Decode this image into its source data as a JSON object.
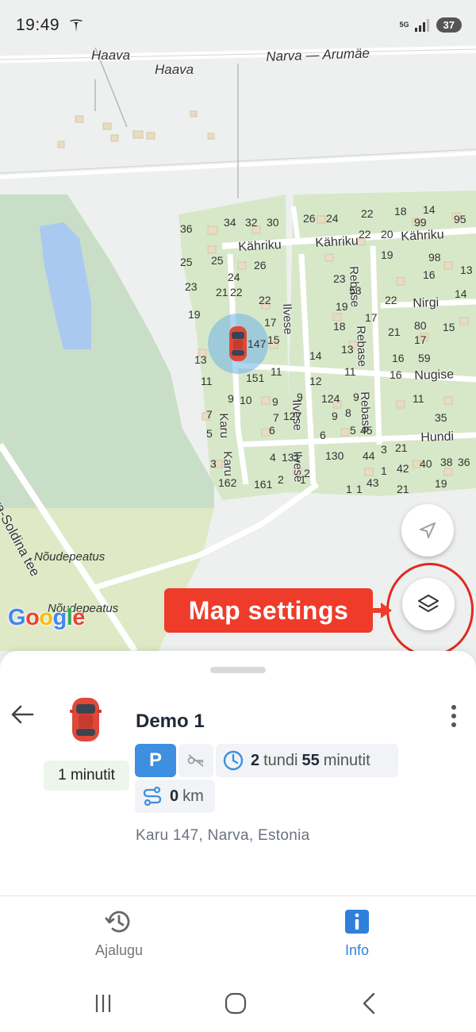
{
  "status_bar": {
    "time": "19:49",
    "network": "5G",
    "battery": "37"
  },
  "map": {
    "road_labels": [
      "Haava",
      "Haava",
      "Narva — Arumäe",
      "Kähriku",
      "Kähriku",
      "Kähriku",
      "Nirgi",
      "Nugise",
      "Hundi",
      "Karu",
      "Karu",
      "Ilvese",
      "Ilvese",
      "Ilvese",
      "Rebase",
      "Rebase",
      "Rebase",
      "Narva-Soldina tee"
    ],
    "area_labels": [
      "Nõudepeatus",
      "Nõudepeatus"
    ],
    "house_numbers": [
      "34",
      "32",
      "30",
      "26",
      "24",
      "22",
      "18",
      "14",
      "95",
      "99",
      "36",
      "22",
      "20",
      "25",
      "25",
      "26",
      "19",
      "98",
      "13",
      "23",
      "24",
      "23",
      "16",
      "21",
      "22",
      "22",
      "53",
      "14",
      "19",
      "22",
      "19",
      "17",
      "18",
      "17",
      "21",
      "80",
      "15",
      "17",
      "15",
      "13",
      "14",
      "13",
      "16",
      "59",
      "11",
      "151",
      "11",
      "12",
      "11",
      "16",
      "9",
      "10",
      "9",
      "9",
      "124",
      "8",
      "9",
      "11",
      "7",
      "7",
      "127",
      "9",
      "35",
      "5",
      "6",
      "6",
      "5",
      "45",
      "21",
      "3",
      "4",
      "131",
      "1",
      "130",
      "44",
      "3",
      "42",
      "40",
      "38",
      "36",
      "162",
      "161",
      "2",
      "1",
      "43",
      "19",
      "1",
      "2",
      "1",
      "21"
    ],
    "marker_label": "147",
    "google_logo": "Google",
    "callout_text": "Map settings",
    "locate_icon": "navigation-arrow-icon",
    "layers_icon": "layers-icon"
  },
  "vehicle": {
    "name": "Demo 1",
    "last_update": "1 minutit",
    "parking_badge": "P",
    "duration_hours": "2",
    "duration_hours_unit": "tundi",
    "duration_minutes": "55",
    "duration_minutes_unit": "minutit",
    "distance_value": "0",
    "distance_unit": "km",
    "address": "Karu 147, Narva, Estonia"
  },
  "tabs": [
    {
      "label": "Ajalugu",
      "icon": "history-icon",
      "active": false
    },
    {
      "label": "Info",
      "icon": "info-icon",
      "active": true
    }
  ],
  "colors": {
    "accent": "#2f7fdc",
    "parking": "#3d8fe0",
    "callout": "#ef3b2a",
    "marker_halo": "#6fb3e8"
  }
}
